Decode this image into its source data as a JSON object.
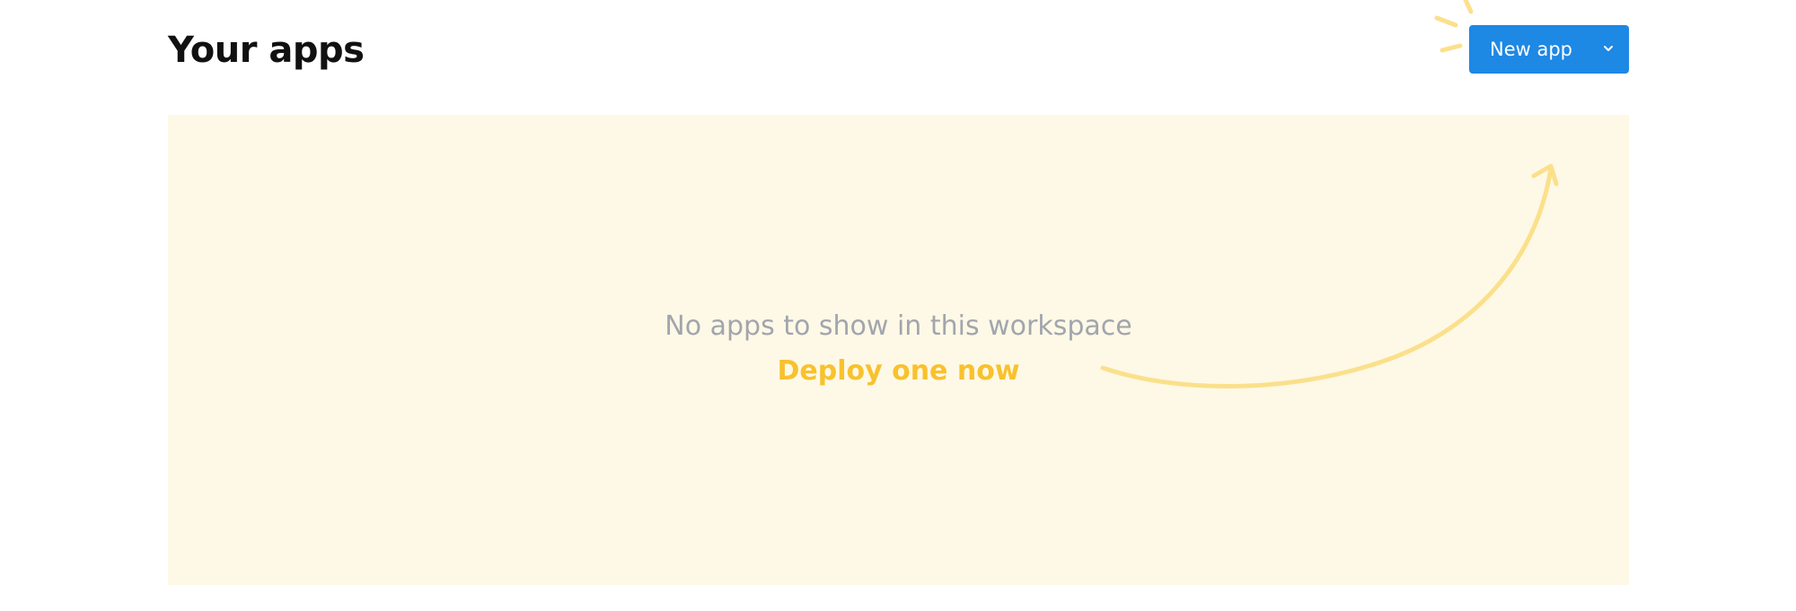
{
  "header": {
    "title": "Your apps",
    "new_app_label": "New app"
  },
  "empty_state": {
    "message": "No apps to show in this workspace",
    "link_text": "Deploy one now"
  },
  "icons": {
    "dropdown": "chevron-down-icon",
    "arrow": "curved-arrow-icon",
    "spark": "spark-lines-icon"
  },
  "colors": {
    "accent_blue": "#1e88e5",
    "empty_bg": "#fef9e6",
    "highlight_yellow": "#f8c12e",
    "arrow_yellow": "#fbe08c",
    "muted_text": "#a2a5ad"
  }
}
